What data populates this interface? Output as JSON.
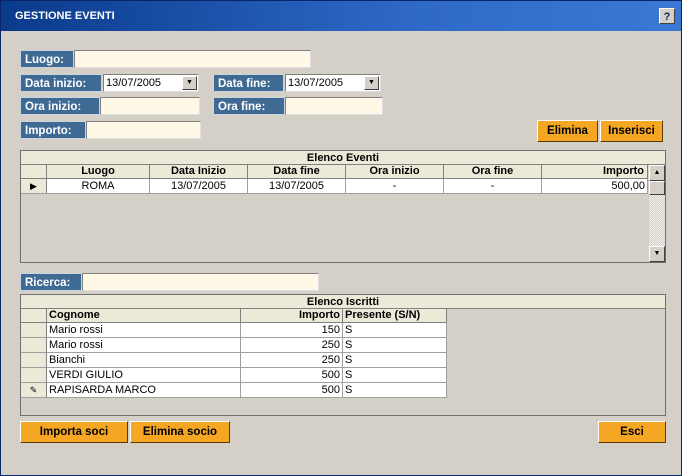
{
  "window": {
    "title": "GESTIONE EVENTI",
    "help_label": "?"
  },
  "form": {
    "luogo_label": "Luogo:",
    "luogo_value": "",
    "data_inizio_label": "Data inizio:",
    "data_inizio_value": "13/07/2005",
    "data_fine_label": "Data fine:",
    "data_fine_value": "13/07/2005",
    "ora_inizio_label": "Ora inizio:",
    "ora_inizio_value": "",
    "ora_fine_label": "Ora fine:",
    "ora_fine_value": "",
    "importo_label": "Importo:",
    "importo_value": ""
  },
  "buttons": {
    "elimina": "Elimina",
    "inserisci": "Inserisci",
    "importa_soci": "Importa soci",
    "elimina_socio": "Elimina socio",
    "esci": "Esci"
  },
  "eventi": {
    "title": "Elenco Eventi",
    "columns": [
      "Luogo",
      "Data Inizio",
      "Data fine",
      "Ora inizio",
      "Ora fine",
      "Importo"
    ],
    "rows": [
      {
        "luogo": "ROMA",
        "data_inizio": "13/07/2005",
        "data_fine": "13/07/2005",
        "ora_inizio": "-",
        "ora_fine": "-",
        "importo": "500,00"
      }
    ]
  },
  "ricerca": {
    "label": "Ricerca:",
    "value": ""
  },
  "iscritti": {
    "title": "Elenco Iscritti",
    "columns": [
      "Cognome",
      "Importo",
      "Presente (S/N)"
    ],
    "rows": [
      {
        "cognome": "Mario rossi",
        "importo": "150",
        "presente": "S"
      },
      {
        "cognome": "Mario rossi",
        "importo": "250",
        "presente": "S"
      },
      {
        "cognome": "Bianchi",
        "importo": "250",
        "presente": "S"
      },
      {
        "cognome": "VERDI GIULIO",
        "importo": "500",
        "presente": "S"
      },
      {
        "cognome": "RAPISARDA MARCO",
        "importo": "500",
        "presente": "S"
      }
    ]
  },
  "colors": {
    "label_bg": "#3f6a93",
    "button_bg": "#f5a623",
    "input_bg": "#fff8e6",
    "title_bar": "#0a3a8a"
  }
}
